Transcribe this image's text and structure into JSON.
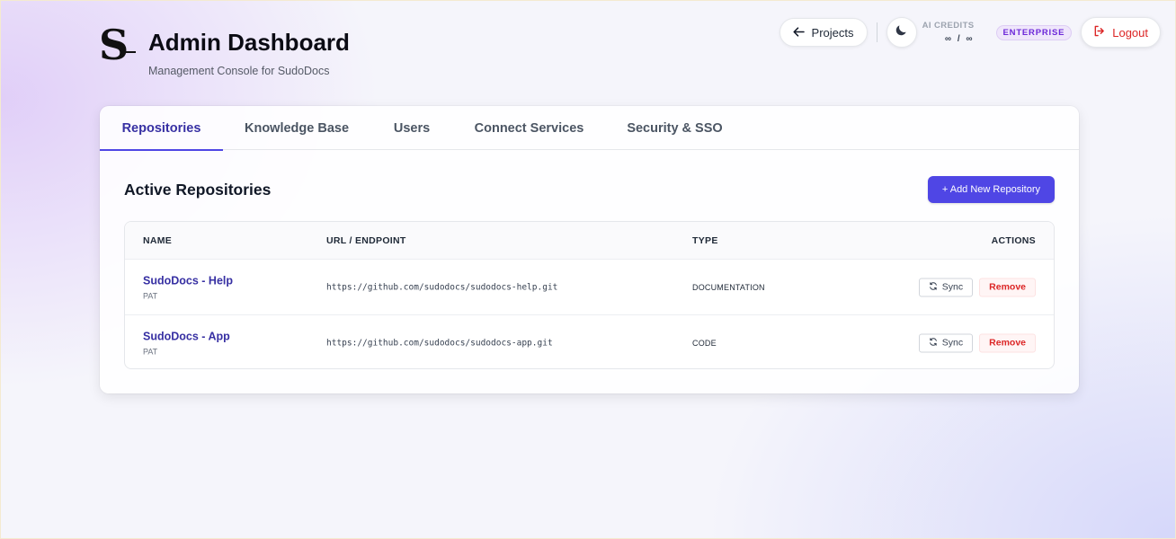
{
  "header": {
    "title": "Admin Dashboard",
    "subtitle": "Management Console for SudoDocs",
    "projects_label": "Projects",
    "credits_label": "AI CREDITS",
    "credits_value": "∞ / ∞",
    "plan_badge": "ENTERPRISE",
    "logout_label": "Logout"
  },
  "tabs": [
    {
      "label": "Repositories",
      "active": true
    },
    {
      "label": "Knowledge Base",
      "active": false
    },
    {
      "label": "Users",
      "active": false
    },
    {
      "label": "Connect Services",
      "active": false
    },
    {
      "label": "Security & SSO",
      "active": false
    }
  ],
  "section": {
    "title": "Active Repositories",
    "add_button": "+ Add New Repository"
  },
  "table": {
    "columns": [
      "NAME",
      "URL / ENDPOINT",
      "TYPE",
      "ACTIONS"
    ],
    "rows": [
      {
        "name": "SudoDocs - Help",
        "auth": "PAT",
        "url": "https://github.com/sudodocs/sudodocs-help.git",
        "type": "DOCUMENTATION",
        "sync": "Sync",
        "remove": "Remove"
      },
      {
        "name": "SudoDocs - App",
        "auth": "PAT",
        "url": "https://github.com/sudodocs/sudodocs-app.git",
        "type": "CODE",
        "sync": "Sync",
        "remove": "Remove"
      }
    ]
  },
  "colors": {
    "accent": "#4f46e5",
    "active_tab_text": "#3730a3",
    "danger": "#dc2626",
    "badge_text": "#6d28d9"
  },
  "icons": {
    "logo": "sudodocs-logo-icon",
    "projects": "arrow-left-icon",
    "theme": "moon-icon",
    "logout": "logout-icon",
    "sync": "refresh-icon"
  }
}
